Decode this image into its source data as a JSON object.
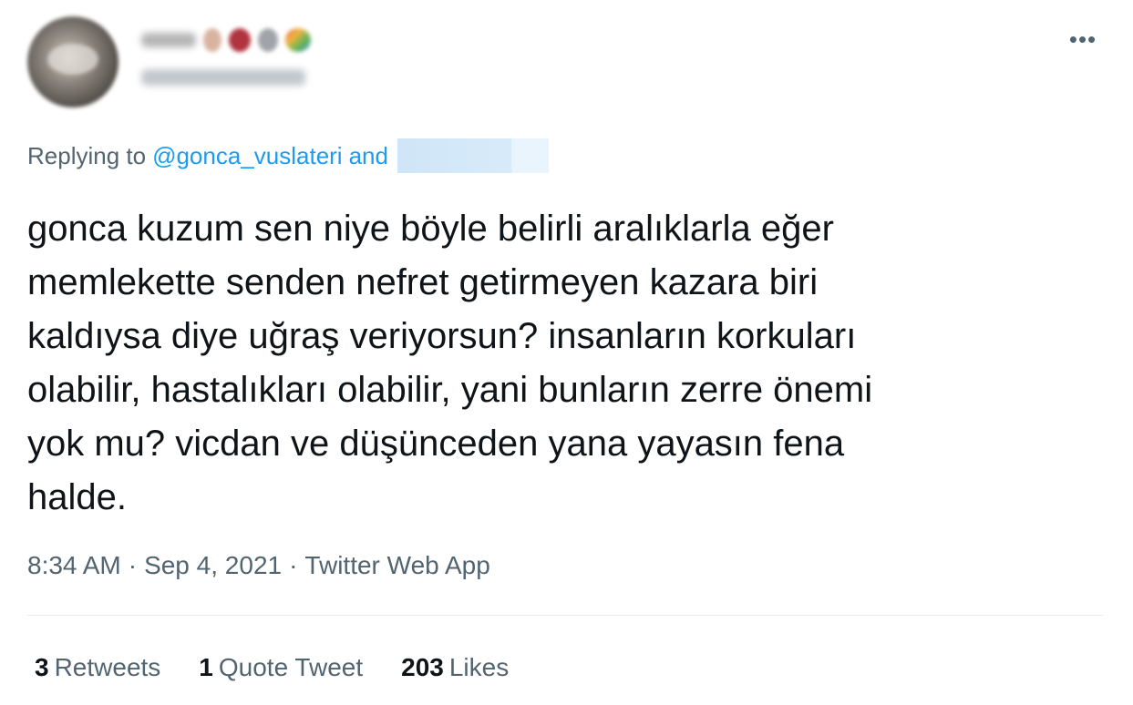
{
  "more_icon": "more-horizontal-icon",
  "reply": {
    "prefix": "Replying to",
    "mention": "@gonca_vuslateri",
    "conjunction": "and"
  },
  "tweet_text": "gonca kuzum sen niye böyle belirli aralıklarla eğer\nmemlekette senden nefret getirmeyen kazara biri\nkaldıysa diye uğraş veriyorsun? insanların korkuları\nolabilir, hastalıkları olabilir, yani bunların zerre önemi\nyok mu? vicdan ve düşünceden yana yayasın fena\nhalde.",
  "meta": {
    "time": "8:34 AM",
    "separator": "·",
    "date": "Sep 4, 2021",
    "source": "Twitter Web App"
  },
  "stats": {
    "retweets_count": "3",
    "retweets_label": "Retweets",
    "quotes_count": "1",
    "quotes_label": "Quote Tweet",
    "likes_count": "203",
    "likes_label": "Likes"
  },
  "colors": {
    "text_primary": "#0f1419",
    "text_secondary": "#536471",
    "link": "#1d9bf0",
    "divider": "#e6ecf0"
  }
}
